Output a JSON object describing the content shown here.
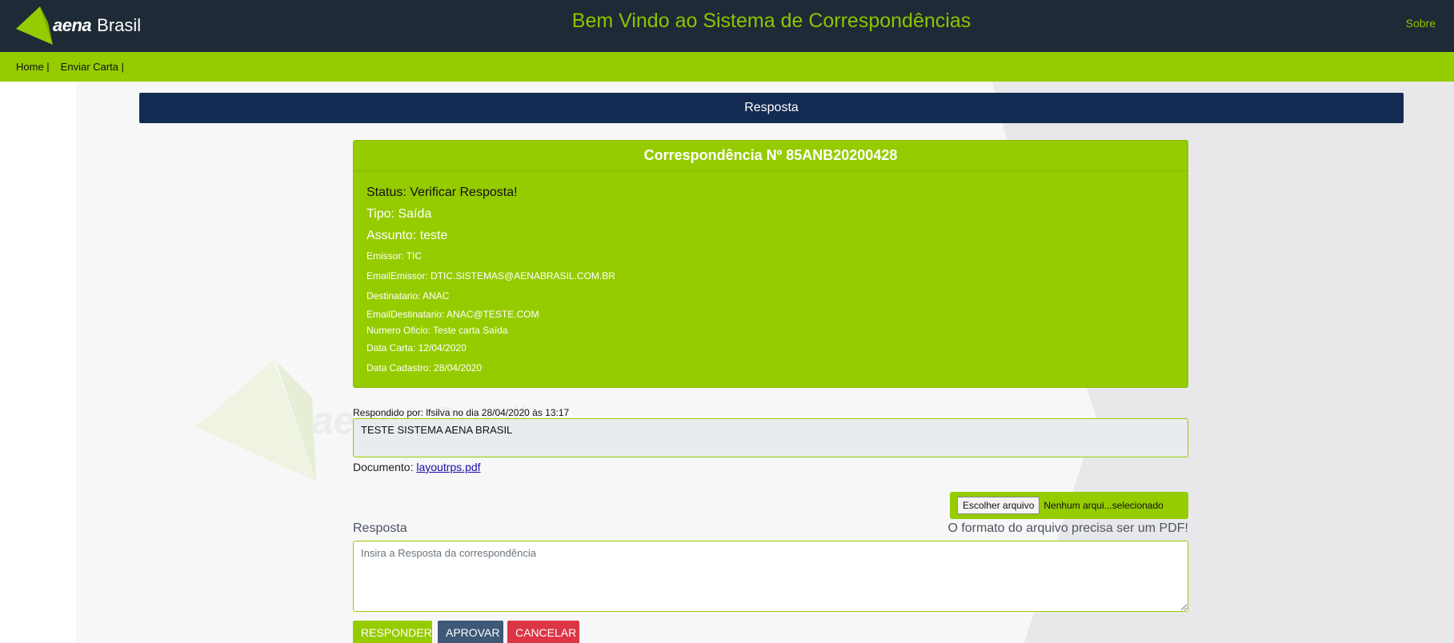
{
  "header": {
    "logo_aena": "aena",
    "logo_brasil": "Brasil",
    "title": "Bem Vindo ao Sistema de Correspondências",
    "about": "Sobre"
  },
  "nav": {
    "home": "Home |",
    "send_letter": "Enviar Carta |"
  },
  "page": {
    "title": "Resposta"
  },
  "card": {
    "heading": "Correspondência Nº 85ANB20200428",
    "status": "Status: Verificar Resposta!",
    "tipo": "Tipo: Saída",
    "assunto": "Assunto: teste",
    "emissor": "Emissor: TIC",
    "email_emissor": "EmailEmissor: DTIC.SISTEMAS@AENABRASIL.COM.BR",
    "destinatario": "Destinatario: ANAC",
    "email_destinatario": "EmailDestinatario: ANAC@TESTE.COM",
    "numero_oficio": "Numero Oficio: Teste carta Saída",
    "data_carta": "Data Carta: 12/04/2020",
    "data_cadastro": "Data Cadastro: 28/04/2020"
  },
  "response": {
    "answered_by": "Respondido por: lfsilva no dia 28/04/2020 às 13:17",
    "text": "TESTE SISTEMA AENA BRASIL",
    "document_label": "Documento:",
    "document_link": "layoutrps.pdf"
  },
  "upload": {
    "choose_file": "Escolher arquivo",
    "no_file": "Nenhum arqui...selecionado",
    "hint": "O formato do arquivo precisa ser um PDF!"
  },
  "reply": {
    "label": "Resposta",
    "placeholder": "Insira a Resposta da correspondência"
  },
  "buttons": {
    "reply": "RESPONDER",
    "approve": "APROVAR",
    "cancel": "CANCELAR"
  },
  "colors": {
    "brand_green": "#95cc00",
    "header_dark": "#1e2a36",
    "title_bar": "#132b52",
    "approve": "#3e5877",
    "cancel": "#dc3545"
  }
}
